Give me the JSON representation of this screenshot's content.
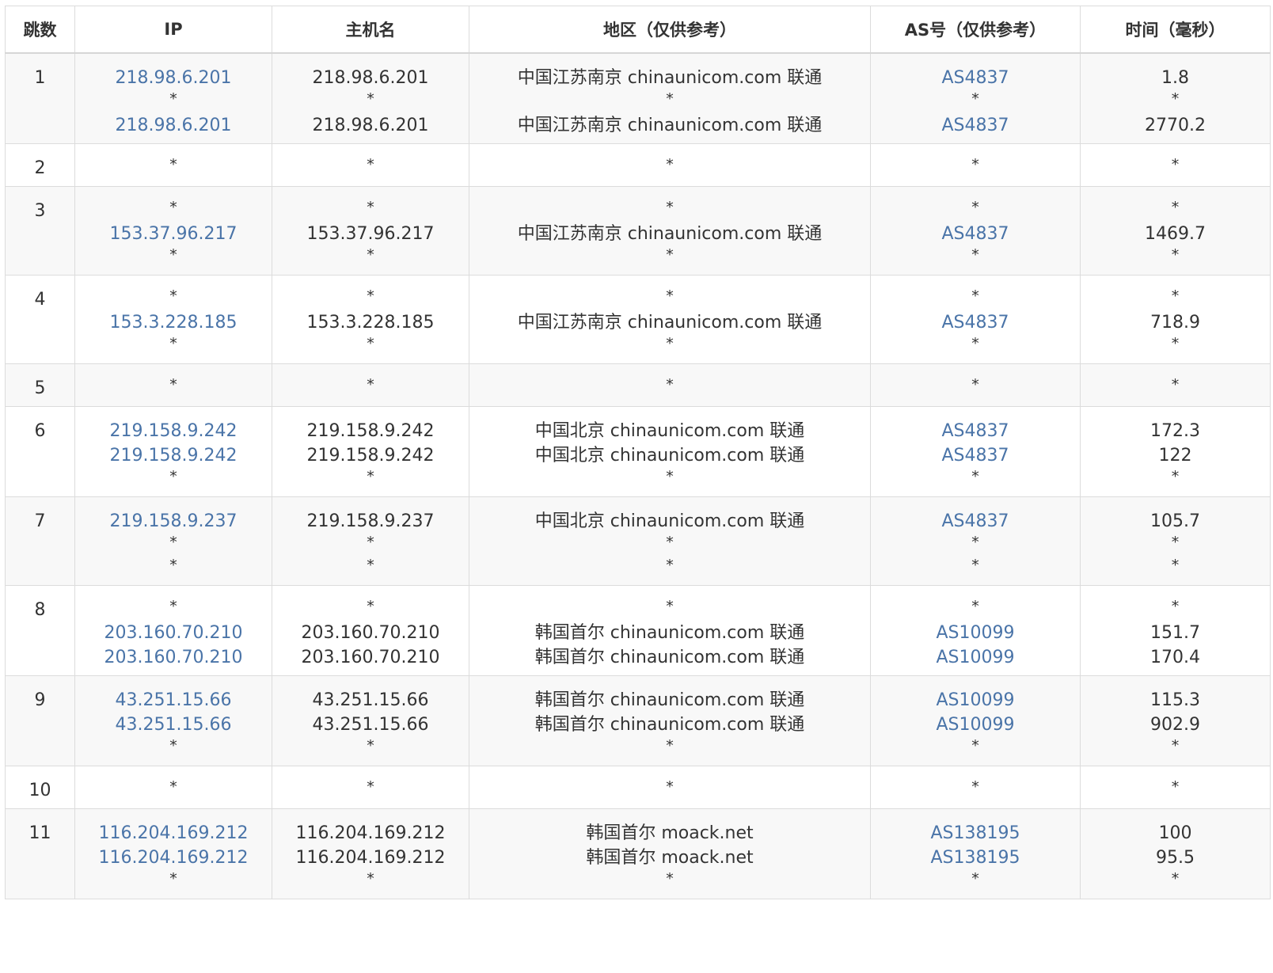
{
  "columns": [
    "跳数",
    "IP",
    "主机名",
    "地区（仅供参考）",
    "AS号（仅供参考）",
    "时间（毫秒）"
  ],
  "rows": [
    {
      "hop": "1",
      "ip": [
        "218.98.6.201",
        "*",
        "218.98.6.201"
      ],
      "host": [
        "218.98.6.201",
        "*",
        "218.98.6.201"
      ],
      "region": [
        "中国江苏南京 chinaunicom.com 联通",
        "*",
        "中国江苏南京 chinaunicom.com 联通"
      ],
      "asn": [
        "AS4837",
        "*",
        "AS4837"
      ],
      "time": [
        "1.8",
        "*",
        "2770.2"
      ]
    },
    {
      "hop": "2",
      "ip": [
        "*"
      ],
      "host": [
        "*"
      ],
      "region": [
        "*"
      ],
      "asn": [
        "*"
      ],
      "time": [
        "*"
      ]
    },
    {
      "hop": "3",
      "ip": [
        "*",
        "153.37.96.217",
        "*"
      ],
      "host": [
        "*",
        "153.37.96.217",
        "*"
      ],
      "region": [
        "*",
        "中国江苏南京 chinaunicom.com 联通",
        "*"
      ],
      "asn": [
        "*",
        "AS4837",
        "*"
      ],
      "time": [
        "*",
        "1469.7",
        "*"
      ]
    },
    {
      "hop": "4",
      "ip": [
        "*",
        "153.3.228.185",
        "*"
      ],
      "host": [
        "*",
        "153.3.228.185",
        "*"
      ],
      "region": [
        "*",
        "中国江苏南京 chinaunicom.com 联通",
        "*"
      ],
      "asn": [
        "*",
        "AS4837",
        "*"
      ],
      "time": [
        "*",
        "718.9",
        "*"
      ]
    },
    {
      "hop": "5",
      "ip": [
        "*"
      ],
      "host": [
        "*"
      ],
      "region": [
        "*"
      ],
      "asn": [
        "*"
      ],
      "time": [
        "*"
      ]
    },
    {
      "hop": "6",
      "ip": [
        "219.158.9.242",
        "219.158.9.242",
        "*"
      ],
      "host": [
        "219.158.9.242",
        "219.158.9.242",
        "*"
      ],
      "region": [
        "中国北京 chinaunicom.com 联通",
        "中国北京 chinaunicom.com 联通",
        "*"
      ],
      "asn": [
        "AS4837",
        "AS4837",
        "*"
      ],
      "time": [
        "172.3",
        "122",
        "*"
      ]
    },
    {
      "hop": "7",
      "ip": [
        "219.158.9.237",
        "*",
        "*"
      ],
      "host": [
        "219.158.9.237",
        "*",
        "*"
      ],
      "region": [
        "中国北京 chinaunicom.com 联通",
        "*",
        "*"
      ],
      "asn": [
        "AS4837",
        "*",
        "*"
      ],
      "time": [
        "105.7",
        "*",
        "*"
      ]
    },
    {
      "hop": "8",
      "ip": [
        "*",
        "203.160.70.210",
        "203.160.70.210"
      ],
      "host": [
        "*",
        "203.160.70.210",
        "203.160.70.210"
      ],
      "region": [
        "*",
        "韩国首尔 chinaunicom.com 联通",
        "韩国首尔 chinaunicom.com 联通"
      ],
      "asn": [
        "*",
        "AS10099",
        "AS10099"
      ],
      "time": [
        "*",
        "151.7",
        "170.4"
      ]
    },
    {
      "hop": "9",
      "ip": [
        "43.251.15.66",
        "43.251.15.66",
        "*"
      ],
      "host": [
        "43.251.15.66",
        "43.251.15.66",
        "*"
      ],
      "region": [
        "韩国首尔 chinaunicom.com 联通",
        "韩国首尔 chinaunicom.com 联通",
        "*"
      ],
      "asn": [
        "AS10099",
        "AS10099",
        "*"
      ],
      "time": [
        "115.3",
        "902.9",
        "*"
      ]
    },
    {
      "hop": "10",
      "ip": [
        "*"
      ],
      "host": [
        "*"
      ],
      "region": [
        "*"
      ],
      "asn": [
        "*"
      ],
      "time": [
        "*"
      ]
    },
    {
      "hop": "11",
      "ip": [
        "116.204.169.212",
        "116.204.169.212",
        "*"
      ],
      "host": [
        "116.204.169.212",
        "116.204.169.212",
        "*"
      ],
      "region": [
        "韩国首尔 moack.net",
        "韩国首尔 moack.net",
        "*"
      ],
      "asn": [
        "AS138195",
        "AS138195",
        "*"
      ],
      "time": [
        "100",
        "95.5",
        "*"
      ]
    }
  ],
  "colors": {
    "link": "#4a74a8",
    "text": "#333333",
    "row_alt": "#f8f8f8",
    "border": "#dcdcdc"
  }
}
